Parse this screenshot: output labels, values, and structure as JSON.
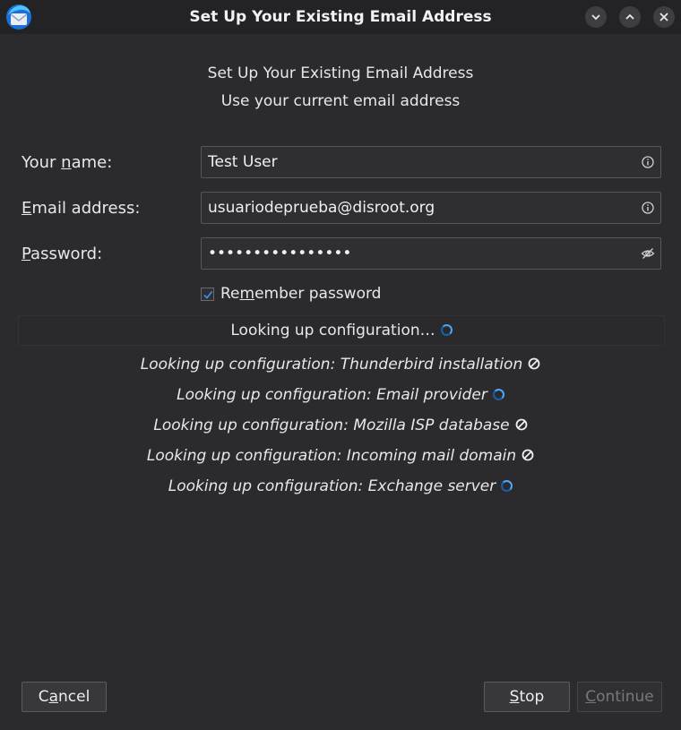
{
  "window": {
    "title": "Set Up Your Existing Email Address"
  },
  "header": {
    "title": "Set Up Your Existing Email Address",
    "subtitle": "Use your current email address"
  },
  "form": {
    "name": {
      "label_pre": "Your ",
      "label_key": "n",
      "label_post": "ame:",
      "value": "Test User"
    },
    "email": {
      "label_key": "E",
      "label_post": "mail address:",
      "value": "usuariodeprueba@disroot.org"
    },
    "password": {
      "label_key": "P",
      "label_post": "assword:",
      "value": "••••••••••••••••"
    },
    "remember": {
      "checked": true,
      "label_pre": "Re",
      "label_key": "m",
      "label_post": "ember password"
    }
  },
  "status": {
    "text": "Looking up configuration…"
  },
  "lookups": [
    {
      "text": "Looking up configuration: Thunderbird installation",
      "state": "failed"
    },
    {
      "text": "Looking up configuration: Email provider",
      "state": "loading"
    },
    {
      "text": "Looking up configuration: Mozilla ISP database",
      "state": "failed"
    },
    {
      "text": "Looking up configuration: Incoming mail domain",
      "state": "failed"
    },
    {
      "text": "Looking up configuration: Exchange server",
      "state": "loading"
    }
  ],
  "buttons": {
    "cancel": {
      "pre": "C",
      "key": "a",
      "post": "ncel"
    },
    "stop": {
      "key": "S",
      "post": "top"
    },
    "continue": {
      "key": "C",
      "post": "ontinue",
      "disabled": true
    }
  },
  "colors": {
    "background": "#2b2b2e",
    "accent": "#4aa6ff",
    "checkbox_accent": "#3b8fe0"
  }
}
